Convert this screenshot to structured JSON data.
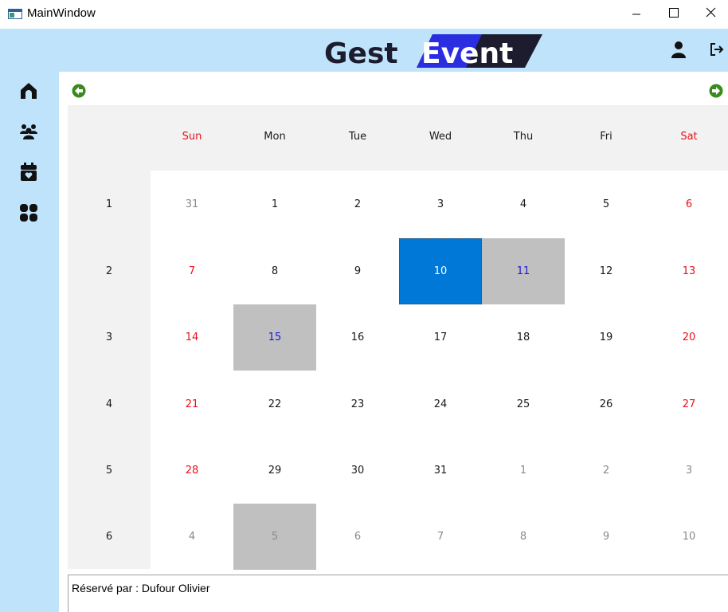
{
  "window": {
    "title": "MainWindow"
  },
  "header": {
    "logo_left": "Gest",
    "logo_right": "Event",
    "accent": "#2a2ee0",
    "logo_dark": "#1c1c2e"
  },
  "sidebar": {
    "icons": [
      "home-icon",
      "users-icon",
      "calendar-heart-icon",
      "grid-icon"
    ]
  },
  "calendar": {
    "days_of_week": [
      "Sun",
      "Mon",
      "Tue",
      "Wed",
      "Thu",
      "Fri",
      "Sat"
    ],
    "week_numbers": [
      "1",
      "2",
      "3",
      "4",
      "5",
      "6"
    ],
    "weeks": [
      [
        {
          "d": "31",
          "other": true
        },
        {
          "d": "1"
        },
        {
          "d": "2"
        },
        {
          "d": "3"
        },
        {
          "d": "4"
        },
        {
          "d": "5"
        },
        {
          "d": "6"
        }
      ],
      [
        {
          "d": "7"
        },
        {
          "d": "8"
        },
        {
          "d": "9"
        },
        {
          "d": "10",
          "selected": true
        },
        {
          "d": "11",
          "booked": true
        },
        {
          "d": "12"
        },
        {
          "d": "13"
        }
      ],
      [
        {
          "d": "14"
        },
        {
          "d": "15",
          "booked": true
        },
        {
          "d": "16"
        },
        {
          "d": "17"
        },
        {
          "d": "18"
        },
        {
          "d": "19"
        },
        {
          "d": "20"
        }
      ],
      [
        {
          "d": "21"
        },
        {
          "d": "22"
        },
        {
          "d": "23"
        },
        {
          "d": "24"
        },
        {
          "d": "25"
        },
        {
          "d": "26"
        },
        {
          "d": "27"
        }
      ],
      [
        {
          "d": "28"
        },
        {
          "d": "29"
        },
        {
          "d": "30"
        },
        {
          "d": "31"
        },
        {
          "d": "1",
          "other": true
        },
        {
          "d": "2",
          "other": true
        },
        {
          "d": "3",
          "other": true
        }
      ],
      [
        {
          "d": "4",
          "other": true
        },
        {
          "d": "5",
          "other": true,
          "booked": true
        },
        {
          "d": "6",
          "other": true
        },
        {
          "d": "7",
          "other": true
        },
        {
          "d": "8",
          "other": true
        },
        {
          "d": "9",
          "other": true
        },
        {
          "d": "10",
          "other": true
        }
      ]
    ],
    "colors": {
      "weekend": "#e8101a",
      "selected": "#0078d7",
      "booked": "#c0c0c0",
      "booked_text": "#1a1ad8",
      "nav_green": "#3a8a1e"
    }
  },
  "reservation": {
    "text": "Réservé par : Dufour Olivier"
  }
}
